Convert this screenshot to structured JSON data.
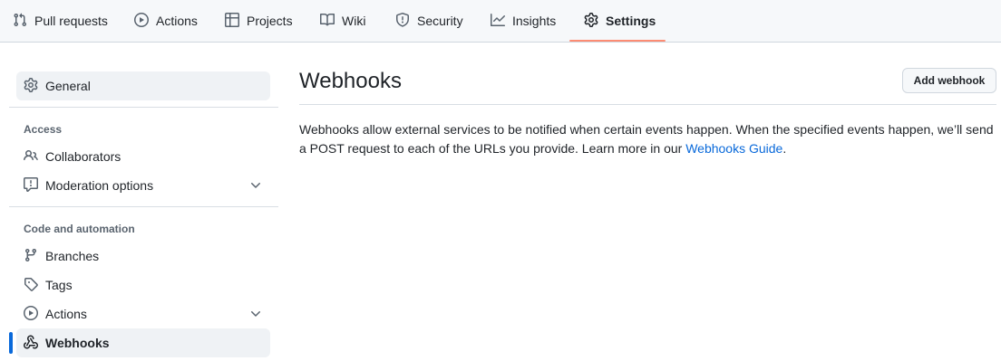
{
  "repo_nav": {
    "tabs": [
      {
        "label": "Pull requests",
        "icon": "git-pull-request-icon"
      },
      {
        "label": "Actions",
        "icon": "play-icon"
      },
      {
        "label": "Projects",
        "icon": "table-icon"
      },
      {
        "label": "Wiki",
        "icon": "book-icon"
      },
      {
        "label": "Security",
        "icon": "shield-icon"
      },
      {
        "label": "Insights",
        "icon": "graph-icon"
      },
      {
        "label": "Settings",
        "icon": "gear-icon",
        "selected": true
      }
    ],
    "accent_color": "#fd8c73"
  },
  "sidebar": {
    "general": {
      "label": "General",
      "icon": "gear-icon"
    },
    "access": {
      "heading": "Access",
      "items": [
        {
          "label": "Collaborators",
          "icon": "people-icon"
        },
        {
          "label": "Moderation options",
          "icon": "report-icon",
          "expandable": true
        }
      ]
    },
    "code_automation": {
      "heading": "Code and automation",
      "items": [
        {
          "label": "Branches",
          "icon": "git-branch-icon"
        },
        {
          "label": "Tags",
          "icon": "tag-icon"
        },
        {
          "label": "Actions",
          "icon": "play-icon",
          "expandable": true
        },
        {
          "label": "Webhooks",
          "icon": "webhook-icon",
          "active": true
        }
      ]
    },
    "active_indicator_color": "#0969da"
  },
  "main": {
    "title": "Webhooks",
    "add_button": "Add webhook",
    "description": "Webhooks allow external services to be notified when certain events happen. When the specified events happen, we’ll send a POST request to each of the URLs you provide. Learn more in our ",
    "guide_link": "Webhooks Guide",
    "description_end": ".",
    "link_color": "#0969da"
  }
}
